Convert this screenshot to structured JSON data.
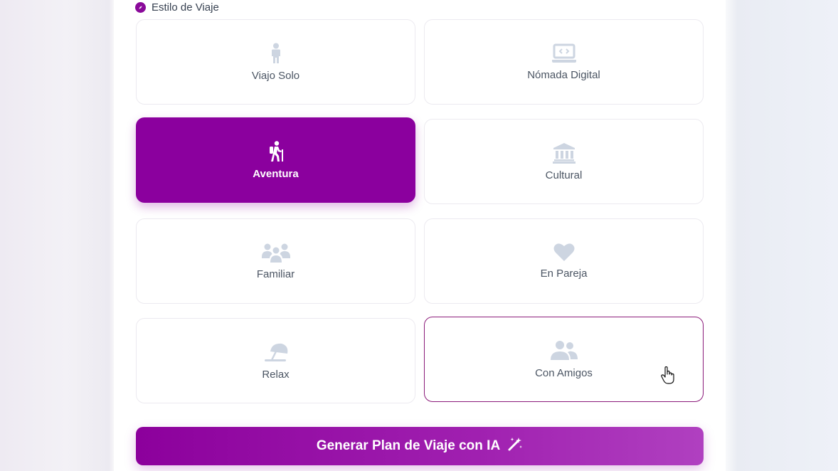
{
  "section": {
    "title": "Estilo de Viaje",
    "icon": "compass-icon"
  },
  "styles": [
    {
      "label": "Viajo Solo",
      "icon": "person-icon",
      "selected": false
    },
    {
      "label": "Nómada Digital",
      "icon": "laptop-code-icon",
      "selected": false
    },
    {
      "label": "Aventura",
      "icon": "hiking-icon",
      "selected": true
    },
    {
      "label": "Cultural",
      "icon": "landmark-icon",
      "selected": false
    },
    {
      "label": "Familiar",
      "icon": "family-icon",
      "selected": false
    },
    {
      "label": "En Pareja",
      "icon": "heart-icon",
      "selected": false
    },
    {
      "label": "Relax",
      "icon": "umbrella-beach-icon",
      "selected": false
    },
    {
      "label": "Con Amigos",
      "icon": "user-friends-icon",
      "selected": false,
      "hovered": true
    }
  ],
  "generate_button": {
    "label": "Generar Plan de Viaje con IA",
    "icon": "magic-wand-icon"
  },
  "colors": {
    "accent": "#8b009e",
    "icon_muted": "#cdd5e1",
    "label": "#4b5563"
  }
}
